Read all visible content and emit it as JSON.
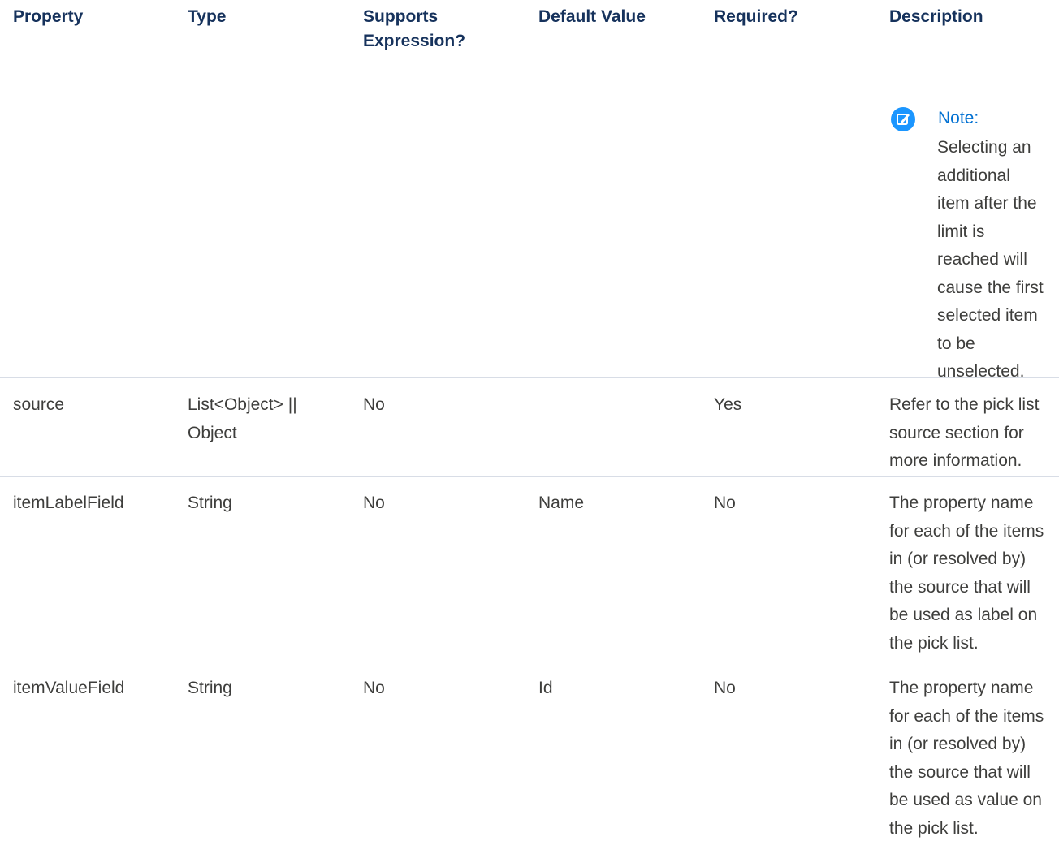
{
  "headers": {
    "property": "Property",
    "type": "Type",
    "supports_expression_line1": "Supports",
    "supports_expression_line2": "Expression?",
    "default_value": "Default Value",
    "required": "Required?",
    "description": "Description"
  },
  "note": {
    "title": "Note:",
    "lines": [
      "Selecting an",
      "additional",
      "item after the",
      "limit is",
      "reached will",
      "cause the first",
      "selected item",
      "to be",
      "unselected."
    ],
    "icon": "edit-note-icon",
    "icon_color": "#1b96ff",
    "title_color": "#0070d2"
  },
  "rows": [
    {
      "property": "source",
      "type": [
        "List<Object> ||",
        "Object"
      ],
      "supports_expression": "No",
      "default_value": "",
      "required": "Yes",
      "description": [
        "Refer to the pick list",
        "source section for",
        "more information."
      ]
    },
    {
      "property": "itemLabelField",
      "type": [
        "String"
      ],
      "supports_expression": "No",
      "default_value": "Name",
      "required": "No",
      "description": [
        "The property name",
        "for each of the items",
        "in (or resolved by)",
        "the source that will",
        "be used as label on",
        "the pick list."
      ]
    },
    {
      "property": "itemValueField",
      "type": [
        "String"
      ],
      "supports_expression": "No",
      "default_value": "Id",
      "required": "No",
      "description": [
        "The property name",
        "for each of the items",
        "in (or resolved by)",
        "the source that will",
        "be used as value on",
        "the pick list."
      ]
    }
  ],
  "colors": {
    "header_text": "#16325c",
    "body_text": "#3e3e3c",
    "divider": "#d8dde6"
  }
}
